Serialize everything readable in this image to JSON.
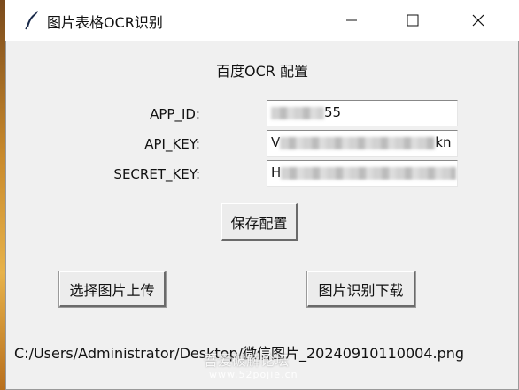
{
  "window": {
    "title": "图片表格OCR识别"
  },
  "section": {
    "title": "百度OCR 配置"
  },
  "fields": [
    {
      "label": "APP_ID:",
      "value_visible": "55"
    },
    {
      "label": "API_KEY:",
      "value_visible_start": "V",
      "value_visible_end": "kn"
    },
    {
      "label": "SECRET_KEY:",
      "value_visible_start": "H"
    }
  ],
  "buttons": {
    "save": "保存配置",
    "select": "选择图片上传",
    "recognize": "图片识别下载"
  },
  "status": {
    "path": "C:/Users/Administrator/Desktop/微信图片_20240910110004.png"
  },
  "watermark": {
    "line1": "吾爱破解论坛",
    "line2": "www.52pojie.cn"
  },
  "icons": {
    "app": "feather-icon",
    "minimize": "minimize-icon",
    "maximize": "maximize-icon",
    "close": "close-icon"
  }
}
